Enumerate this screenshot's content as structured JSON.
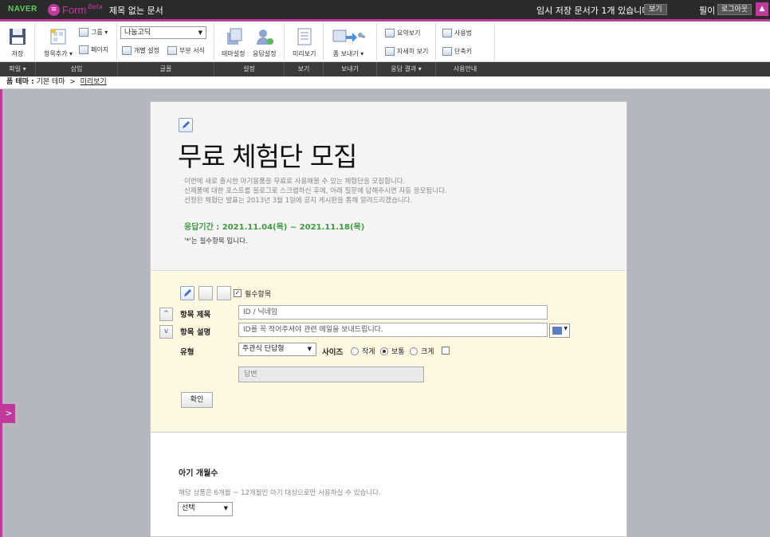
{
  "topbar": {
    "naver": "NAVER",
    "form_logo": "Form",
    "beta": "Beta",
    "doc_title": "제목 없는 문서",
    "saved_status": "임시 저장 문서가 1개 있습니다.",
    "view_label": "보기",
    "user": "필이",
    "logout_label": "로그아웃"
  },
  "ribbon": {
    "save": "저장",
    "add_item": "항목추가",
    "group": "그룹",
    "page": "페이지",
    "font": "나눔고딕",
    "individual_setting": "개별 설정",
    "partial_format": "부분 서식",
    "theme_setting": "테마설정",
    "response_setting": "응답설정",
    "preview": "미리보기",
    "send_form": "폼 보내기",
    "summary_view": "요약보기",
    "detail_view": "자세히 보기",
    "how_to_use": "사용법",
    "shortcut": "단축키"
  },
  "tabs": [
    "파일",
    "삽입",
    "글꼴",
    "설정",
    "보기",
    "보내기",
    "응답 결과",
    "사용안내"
  ],
  "breadcrumb": {
    "label": "폼 테마 :",
    "theme": "기본 테마",
    "sep": ">",
    "preview": "미리보기"
  },
  "form": {
    "title": "무료 체험단 모집",
    "desc_lines": [
      "이번에 새로 출시한 아기용품을 무료로 사용해볼 수 있는 체험단을 모집합니다.",
      "신제품에 대한 포스트를 블로그로 스크랩하신 후에, 아래 질문에 답해주시면 자동 응모됩니다.",
      "선정된 체험단 발표는 2013년 3월 1일에 공지 게시판을 통해 알려드리겠습니다."
    ],
    "period": "응답기간 : 2021.11.04(목) ~ 2021.11.18(목)",
    "required_note": "'*'는 필수항목 입니다."
  },
  "editor": {
    "required_label": "필수항목",
    "title_label": "항목 제목",
    "title_value": "ID / 닉네임",
    "desc_label": "항목 설명",
    "desc_value": "ID를 꼭 적어주셔야 관련 메일을 보내드립니다.",
    "type_label": "유형",
    "type_value": "주관식 단답형",
    "size_label": "사이즈",
    "size_small": "작게",
    "size_normal": "보통",
    "size_large": "크게",
    "answer_placeholder": "답변",
    "confirm": "확인"
  },
  "question2": {
    "title": "아기 개월수",
    "desc": "해당 상품은 6개월 ~ 12개월인 아기 대상으로만 사용하실 수 있습니다.",
    "select": "선택"
  },
  "colors": {
    "accent": "#c2399c",
    "period_green": "#3c9a3c",
    "edit_bg": "#fdf9e1"
  }
}
